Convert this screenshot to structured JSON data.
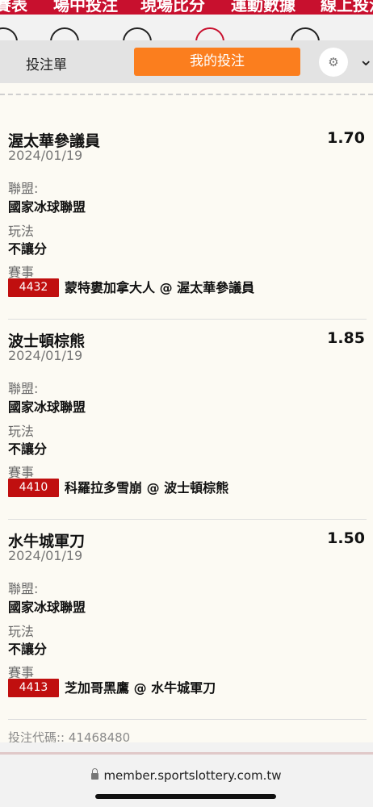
{
  "top_nav": {
    "items": [
      "賽表",
      "場中投注",
      "現場比分",
      "運動數據",
      "線上投注"
    ]
  },
  "icon_strip": {
    "icons": [
      "basketball-icon",
      "globe-icon",
      "soccer-icon",
      "hockey-icon",
      "trophy-icon"
    ],
    "selected": "hockey-icon"
  },
  "tabs": {
    "bet_slip": "投注單",
    "my_bets": "我的投注",
    "settings_icon": "gear-icon",
    "collapse_icon": "chevron-down-icon"
  },
  "labels": {
    "league": "聯盟:",
    "play": "玩法",
    "match": "賽事"
  },
  "bets": [
    {
      "team": "渥太華參議員",
      "odds": "1.70",
      "date": "2024/01/19",
      "league": "國家冰球聯盟",
      "play": "不讓分",
      "match_no": "4432",
      "match": "蒙特婁加拿大人 @ 渥太華參議員"
    },
    {
      "team": "波士頓棕熊",
      "odds": "1.85",
      "date": "2024/01/19",
      "league": "國家冰球聯盟",
      "play": "不讓分",
      "match_no": "4410",
      "match": "科羅拉多雪崩 @ 波士頓棕熊"
    },
    {
      "team": "水牛城軍刀",
      "odds": "1.50",
      "date": "2024/01/19",
      "league": "國家冰球聯盟",
      "play": "不讓分",
      "match_no": "4413",
      "match": "芝加哥黑鷹 @ 水牛城軍刀"
    }
  ],
  "bet_code": "投注代碼:: 41468480",
  "browser": {
    "url": "member.sportslottery.com.tw"
  },
  "colors": {
    "brand_red": "#c8102e",
    "active_tab": "#fb7e1e",
    "badge_red": "#c00f0f"
  }
}
